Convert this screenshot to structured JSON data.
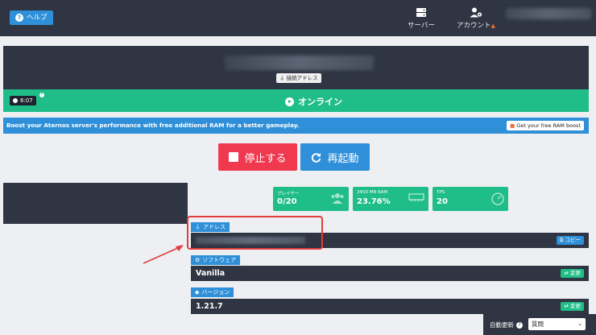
{
  "topbar": {
    "help_label": "ヘルプ",
    "help_icon": "question-circle-icon",
    "server_label": "サーバー",
    "server_icon": "server-icon",
    "account_label": "アカウント",
    "account_icon": "user-gear-icon",
    "account_caret": "▲"
  },
  "server": {
    "address_badge": "接続アドレス",
    "timer": "6:07",
    "status": "オンライン"
  },
  "promo": {
    "text": "Boost your Aternos server's performance with free additional RAM for a better gameplay.",
    "button": "Get your free RAM boost"
  },
  "controls": {
    "stop_label": "停止する",
    "restart_label": "再起動"
  },
  "stats": {
    "players_label": "プレイヤー",
    "players_value": "0/20",
    "ram_label": "3450 MB RAM",
    "ram_value": "23.76%",
    "tps_label": "TPS",
    "tps_value": "20"
  },
  "info": {
    "address_tag": "アドレス",
    "copy_label": "コピー",
    "software_tag": "ソフトウェア",
    "software_value": "Vanilla",
    "software_change": "変更",
    "version_tag": "バージョン",
    "version_value": "1.21.7",
    "version_change": "変更"
  },
  "auto_refresh": {
    "label": "自動更新",
    "selected": "質問"
  },
  "colors": {
    "dark": "#2f3542",
    "green": "#1fbd87",
    "blue": "#2f8fd8",
    "red": "#f0384f",
    "annotation": "#e23c3c"
  }
}
